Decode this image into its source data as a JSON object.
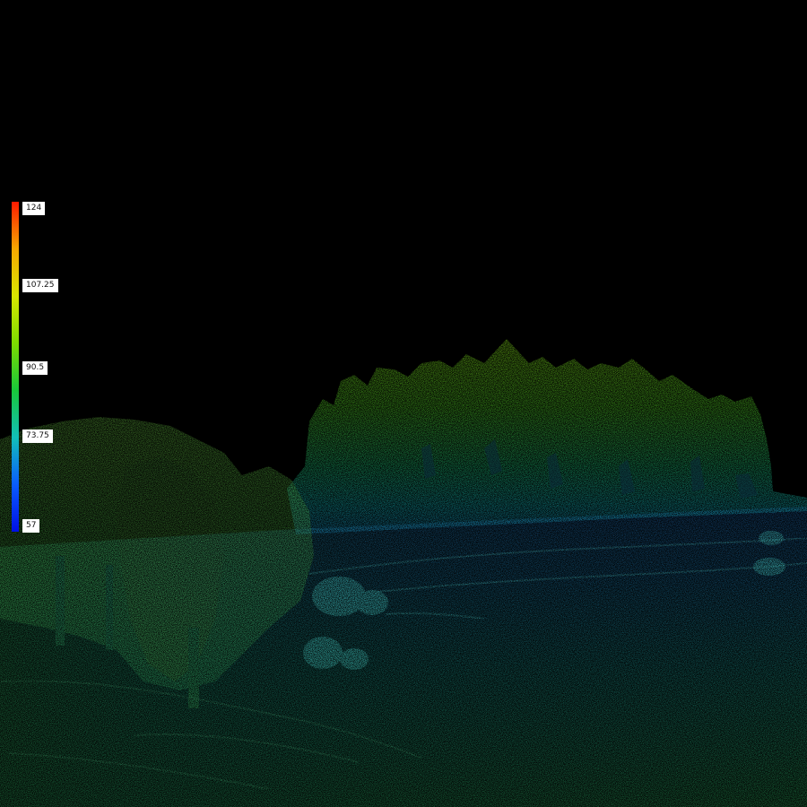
{
  "colorbar": {
    "labels": [
      "124",
      "107.25",
      "90.5",
      "73.75",
      "57"
    ],
    "colors": [
      "#ff1a00",
      "#f5a800",
      "#d9e600",
      "#7ddc00",
      "#18c83a",
      "#12c0b8",
      "#0a5cff",
      "#0010e6"
    ]
  },
  "scene": {
    "background": "#000000",
    "foreground_color": "#2f9a55",
    "mid_color": "#1a6e9e",
    "forest_top_color": "#7ee21f",
    "forest_base_color": "#1fc1b0"
  }
}
